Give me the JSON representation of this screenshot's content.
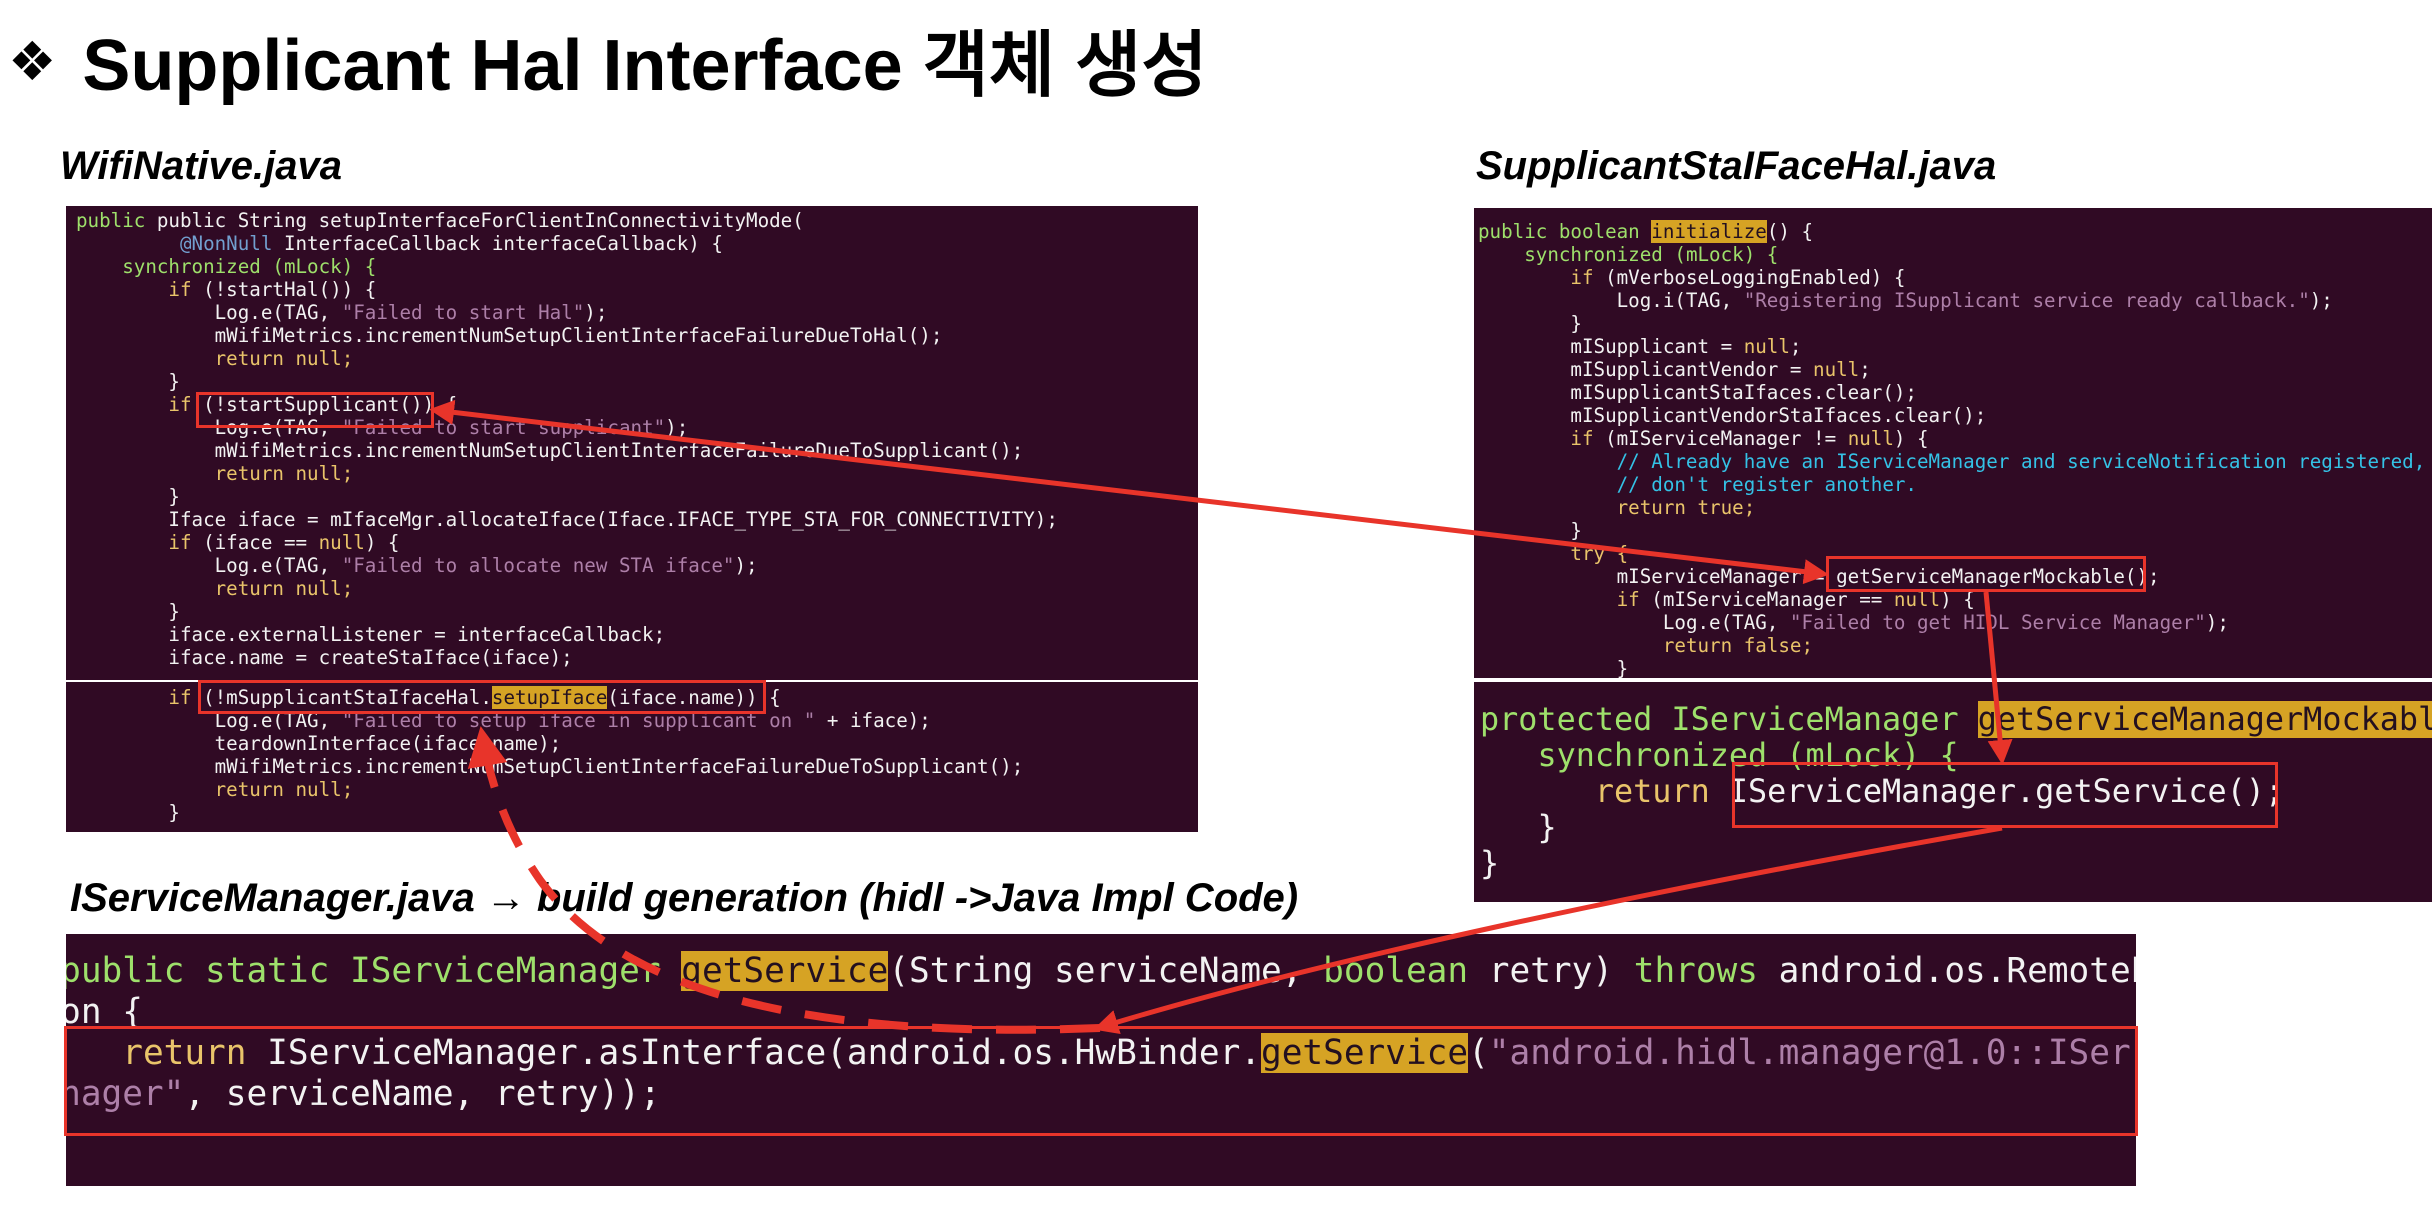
{
  "title": {
    "bullet": "❖",
    "text": "Supplicant Hal Interface 객체 생성"
  },
  "labels": {
    "wifinative": "WifiNative.java",
    "supplicant": "SupplicantStaIFaceHal.java",
    "iservice": "IServiceManager.java → build generation (hidl ->Java Impl Code)"
  },
  "wifinative": {
    "l1": "public String setupInterfaceForClientInConnectivityMode(",
    "l2_ann": "@NonNull",
    "l2": " InterfaceCallback interfaceCallback) {",
    "l3": "synchronized (mLock) {",
    "l4_kw": "if",
    "l4": " (!startHal()) {",
    "l5a": "Log.e(TAG, ",
    "l5s": "\"Failed to start Hal\"",
    "l5b": ");",
    "l6": "mWifiMetrics.incrementNumSetupClientInterfaceFailureDueToHal();",
    "l7": "return null;",
    "l8": "}",
    "l9_kw": "if",
    "l9": " (!startSupplicant()) {",
    "l10a": "Log.e(TAG, ",
    "l10s": "\"Failed to start supplicant\"",
    "l10b": ");",
    "l11": "mWifiMetrics.incrementNumSetupClientInterfaceFailureDueToSupplicant();",
    "l12": "return null;",
    "l13": "}",
    "l14": "Iface iface = mIfaceMgr.allocateIface(Iface.IFACE_TYPE_STA_FOR_CONNECTIVITY);",
    "l15_kw": "if",
    "l15a": " (iface == ",
    "l15n": "null",
    "l15b": ") {",
    "l16a": "Log.e(TAG, ",
    "l16s": "\"Failed to allocate new STA iface\"",
    "l16b": ");",
    "l17": "return null;",
    "l18": "}",
    "l19": "iface.externalListener = interfaceCallback;",
    "l20": "iface.name = createStaIface(iface);"
  },
  "wifinative2": {
    "l1_kw": "if",
    "l1a": " (!mSupplicantStaIfaceHal.",
    "l1h": "setupIface",
    "l1b": "(iface.name)) {",
    "l2a": "Log.e(TAG, ",
    "l2s": "\"Failed to setup iface in supplicant on \"",
    "l2b": " + iface);",
    "l3": "teardownInterface(iface.name);",
    "l4": "mWifiMetrics.incrementNumSetupClientInterfaceFailureDueToSupplicant();",
    "l5": "return null;",
    "l6": "}"
  },
  "supplicant": {
    "l1a": "public boolean ",
    "l1h": "initialize",
    "l1b": "() {",
    "l2": "synchronized (mLock) {",
    "l3_kw": "if",
    "l3": " (mVerboseLoggingEnabled) {",
    "l4a": "Log.i(TAG, ",
    "l4s": "\"Registering ISupplicant service ready callback.\"",
    "l4b": ");",
    "l5": "}",
    "l6a": "mISupplicant = ",
    "l6n": "null",
    "l7a": "mISupplicantVendor = ",
    "l8": "mISupplicantStaIfaces.clear();",
    "l9": "mISupplicantVendorStaIfaces.clear();",
    "l10_kw": "if",
    "l10a": " (mIServiceManager != ",
    "l10b": ") {",
    "l11": "// Already have an IServiceManager and serviceNotification registered, d",
    "l12": "// don't register another.",
    "l13": "return true;",
    "l14": "}",
    "l15": "try {",
    "l16a": "mIServiceManager = ",
    "l16b": "getServiceManagerMockable();",
    "l17a": " (mIServiceManager == ",
    "l17b": ") {",
    "l18a": "Log.e(TAG, ",
    "l18s": "\"Failed to get HIDL Service Manager\"",
    "l18b": ");",
    "l19": "return false;",
    "l20": "}"
  },
  "supplicant2": {
    "l1a": "protected IServiceManager ",
    "l1h": "getServiceManagerMockable",
    "l1b": "()",
    "l2": "synchronized (mLock) {",
    "l3k": "return",
    "l3": " IServiceManager.getService();",
    "l4": "}",
    "l5": "}"
  },
  "iservice": {
    "l1a": "public static IServiceManager ",
    "l1h": "getService",
    "l1b": "(String serviceName, ",
    "l1c": "boolean",
    "l1d": " retry) ",
    "l1e": "throws",
    "l1f": " android.os.RemoteE",
    "l2": "ption {",
    "l3k": "return",
    "l3a": " IServiceManager.asInterface(android.os.HwBinder.",
    "l3h": "getService",
    "l3b": "(",
    "l3s": "\"android.hidl.manager@1.0::ISer",
    "l4s": "eManager\"",
    "l4b": ", serviceName, retry));",
    "l5": "}"
  },
  "colors": {
    "panel_bg": "#300a24",
    "highlight": "#d6a324",
    "arrow": "#e8342a"
  }
}
